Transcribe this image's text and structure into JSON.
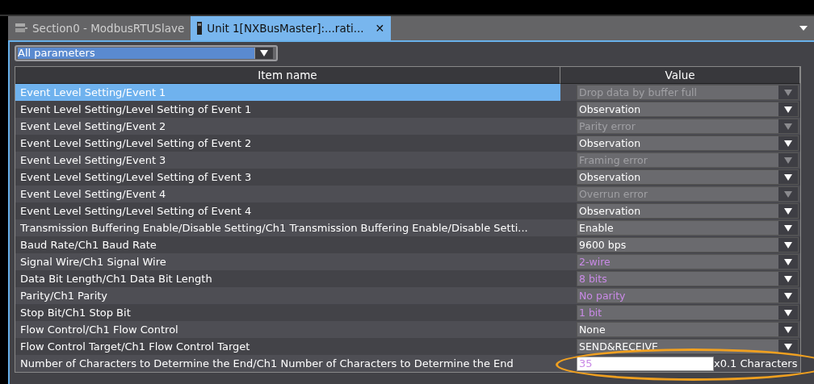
{
  "tabs": [
    {
      "label": "Section0 - ModbusRTUSlave",
      "selected": false
    },
    {
      "label": "Unit 1[NXBusMaster]:...rati...",
      "selected": true,
      "close": "✕"
    }
  ],
  "filter": {
    "value": "All parameters"
  },
  "table": {
    "columns": [
      "Item name",
      "Value"
    ],
    "rows": [
      {
        "name": "Event Level Setting/Event 1",
        "value": "Drop data by buffer full",
        "kind": "dropdown",
        "disabled": true,
        "modified": false,
        "selected": true
      },
      {
        "name": "Event Level Setting/Level Setting of Event 1",
        "value": "Observation",
        "kind": "dropdown",
        "disabled": false,
        "modified": false,
        "selected": false
      },
      {
        "name": "Event Level Setting/Event 2",
        "value": "Parity error",
        "kind": "dropdown",
        "disabled": true,
        "modified": false,
        "selected": false
      },
      {
        "name": "Event Level Setting/Level Setting of Event 2",
        "value": "Observation",
        "kind": "dropdown",
        "disabled": false,
        "modified": false,
        "selected": false
      },
      {
        "name": "Event Level Setting/Event 3",
        "value": "Framing error",
        "kind": "dropdown",
        "disabled": true,
        "modified": false,
        "selected": false
      },
      {
        "name": "Event Level Setting/Level Setting of Event 3",
        "value": "Observation",
        "kind": "dropdown",
        "disabled": false,
        "modified": false,
        "selected": false
      },
      {
        "name": "Event Level Setting/Event 4",
        "value": "Overrun error",
        "kind": "dropdown",
        "disabled": true,
        "modified": false,
        "selected": false
      },
      {
        "name": "Event Level Setting/Level Setting of Event 4",
        "value": "Observation",
        "kind": "dropdown",
        "disabled": false,
        "modified": false,
        "selected": false
      },
      {
        "name": "Transmission Buffering Enable/Disable Setting/Ch1 Transmission Buffering Enable/Disable Setti...",
        "value": "Enable",
        "kind": "dropdown",
        "disabled": false,
        "modified": false,
        "selected": false
      },
      {
        "name": "Baud Rate/Ch1 Baud Rate",
        "value": "9600 bps",
        "kind": "dropdown",
        "disabled": false,
        "modified": false,
        "selected": false
      },
      {
        "name": "Signal Wire/Ch1 Signal Wire",
        "value": "2-wire",
        "kind": "dropdown",
        "disabled": false,
        "modified": true,
        "selected": false
      },
      {
        "name": "Data Bit Length/Ch1 Data Bit Length",
        "value": "8 bits",
        "kind": "dropdown",
        "disabled": false,
        "modified": true,
        "selected": false
      },
      {
        "name": "Parity/Ch1 Parity",
        "value": "No parity",
        "kind": "dropdown",
        "disabled": false,
        "modified": true,
        "selected": false
      },
      {
        "name": "Stop Bit/Ch1 Stop Bit",
        "value": "1 bit",
        "kind": "dropdown",
        "disabled": false,
        "modified": true,
        "selected": false
      },
      {
        "name": "Flow Control/Ch1 Flow Control",
        "value": "None",
        "kind": "dropdown",
        "disabled": false,
        "modified": false,
        "selected": false
      },
      {
        "name": "Flow Control Target/Ch1 Flow Control Target",
        "value": "SEND&RECEIVE",
        "kind": "dropdown",
        "disabled": false,
        "modified": false,
        "selected": false
      },
      {
        "name": "Number of Characters to Determine the End/Ch1 Number of Characters to Determine the End",
        "value": "35",
        "unit": "x0.1 Characters",
        "kind": "input",
        "disabled": false,
        "modified": true,
        "selected": false,
        "highlighted": true
      }
    ]
  }
}
